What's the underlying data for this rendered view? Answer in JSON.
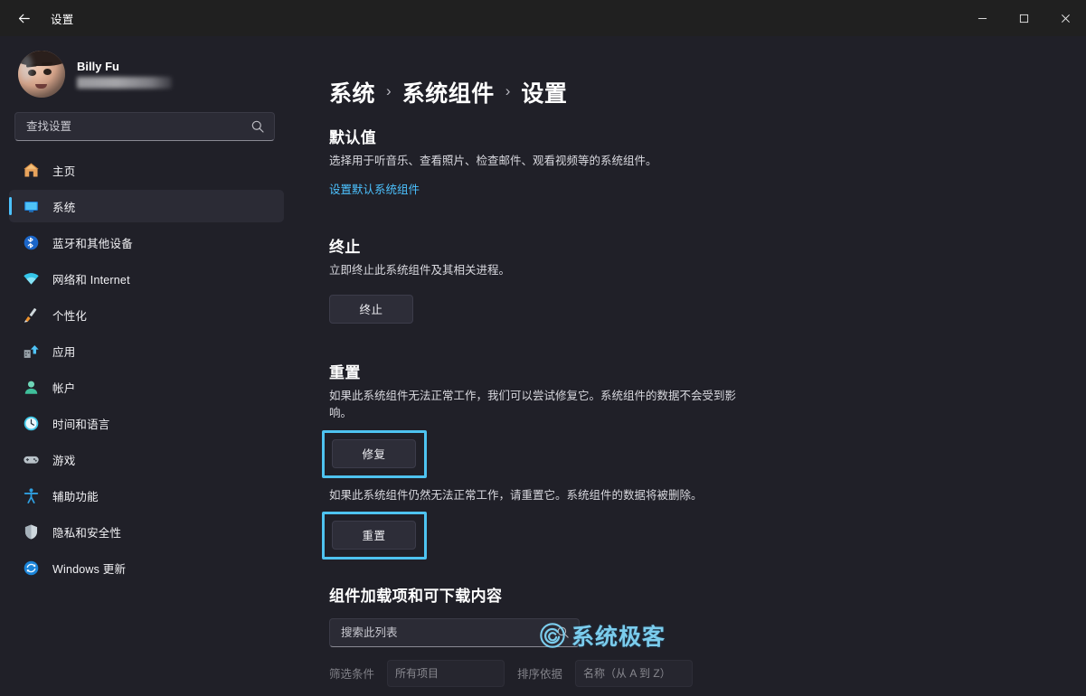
{
  "window": {
    "title": "设置",
    "back_icon": "back-arrow-icon",
    "controls": {
      "minimize": "minimize-icon",
      "maximize": "restore-icon",
      "close": "close-icon"
    }
  },
  "sidebar": {
    "profile": {
      "name": "Billy Fu",
      "email_redacted": ""
    },
    "search": {
      "placeholder": "查找设置",
      "value": "",
      "icon": "search-icon"
    },
    "items": [
      {
        "label": "主页",
        "icon": "home-icon",
        "selected": false
      },
      {
        "label": "系统",
        "icon": "system-display-icon",
        "selected": true
      },
      {
        "label": "蓝牙和其他设备",
        "icon": "bluetooth-icon",
        "selected": false
      },
      {
        "label": "网络和 Internet",
        "icon": "wifi-icon",
        "selected": false
      },
      {
        "label": "个性化",
        "icon": "paintbrush-icon",
        "selected": false
      },
      {
        "label": "应用",
        "icon": "apps-icon",
        "selected": false
      },
      {
        "label": "帐户",
        "icon": "account-icon",
        "selected": false
      },
      {
        "label": "时间和语言",
        "icon": "clock-icon",
        "selected": false
      },
      {
        "label": "游戏",
        "icon": "gamepad-icon",
        "selected": false
      },
      {
        "label": "辅助功能",
        "icon": "accessibility-icon",
        "selected": false
      },
      {
        "label": "隐私和安全性",
        "icon": "shield-icon",
        "selected": false
      },
      {
        "label": "Windows 更新",
        "icon": "update-icon",
        "selected": false
      }
    ]
  },
  "content": {
    "breadcrumb": [
      {
        "label": "系统"
      },
      {
        "label": "系统组件"
      },
      {
        "label": "设置"
      }
    ],
    "breadcrumb_separator": "›",
    "defaults": {
      "title": "默认值",
      "description": "选择用于听音乐、查看照片、检查邮件、观看视频等的系统组件。",
      "link": "设置默认系统组件"
    },
    "terminate": {
      "title": "终止",
      "description": "立即终止此系统组件及其相关进程。",
      "button": "终止"
    },
    "reset": {
      "title": "重置",
      "repair_description": "如果此系统组件无法正常工作，我们可以尝试修复它。系统组件的数据不会受到影响。",
      "repair_button": "修复",
      "reset_description": "如果此系统组件仍然无法正常工作，请重置它。系统组件的数据将被删除。",
      "reset_button": "重置"
    },
    "addons": {
      "title": "组件加载项和可下载内容",
      "search_placeholder": "搜索此列表",
      "search_value": "",
      "search_icon": "search-icon",
      "filter_label": "筛选条件",
      "filter_value": "所有项目",
      "sort_label": "排序依据",
      "sort_value": "名称（从 A 到 Z）"
    }
  },
  "watermark": {
    "text": "系统极客",
    "logo": "spiral-logo-icon",
    "color": "#7fd4f5"
  },
  "colors": {
    "accent": "#4cc2ff",
    "highlight_box": "#4ec3f0",
    "background": "#202028",
    "titlebar": "#202020",
    "button_fill": "#2d2d38"
  }
}
